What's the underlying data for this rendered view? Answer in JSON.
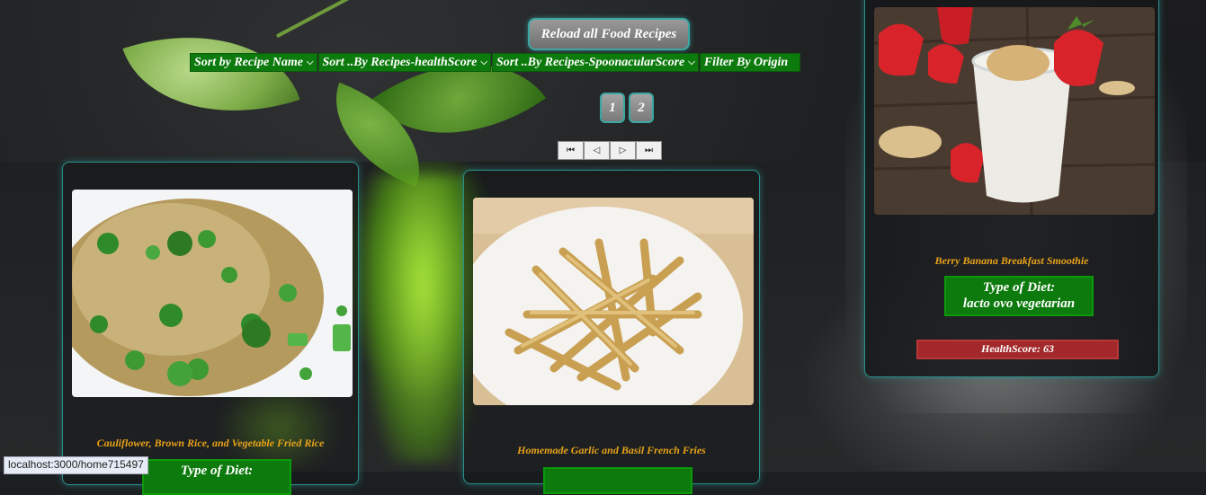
{
  "toolbar": {
    "reload_label": "Reload all Food Recipes",
    "sort_name_label": "Sort by Recipe Name",
    "sort_health_label": "Sort ..By Recipes-healthScore",
    "sort_spoon_label": "Sort ..By Recipes-SpoonacularScore",
    "filter_origin_label": "Filter By Origin"
  },
  "pagination": {
    "pages": [
      "1",
      "2"
    ],
    "nav_icons": [
      "first-page-icon",
      "previous-page-icon",
      "next-page-icon",
      "last-page-icon"
    ],
    "nav_glyphs": [
      "⏮",
      "◁",
      "▷",
      "⏭"
    ]
  },
  "cards": [
    {
      "title": "Cauliflower, Brown Rice, and Vegetable Fried Rice",
      "diet_label": "Type of Diet:"
    },
    {
      "title": "Homemade Garlic and Basil French Fries"
    },
    {
      "title": "Berry Banana Breakfast Smoothie",
      "diet_label": "Type of Diet:",
      "diet_value": "lacto ovo vegetarian",
      "health": "HealthScore: 63"
    }
  ],
  "status_bar": {
    "url": "localhost:3000/home715497"
  },
  "colors": {
    "accent_teal": "#3aa7a3",
    "button_green": "#0d7a0d",
    "title_orange": "#e8a21a",
    "health_red": "#a3282a"
  }
}
